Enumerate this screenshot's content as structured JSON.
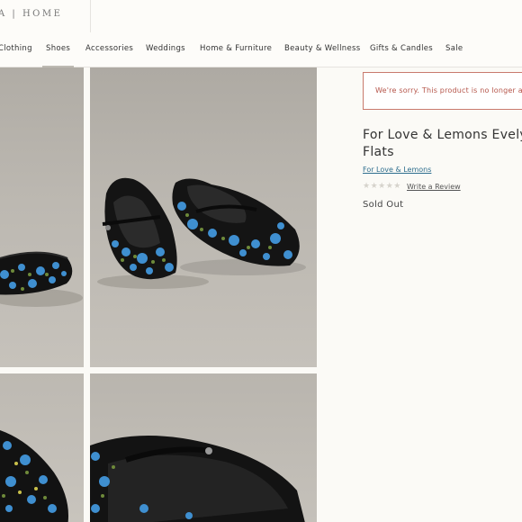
{
  "header": {
    "brand": "A | HOME"
  },
  "nav": {
    "items": [
      {
        "label": "Clothing"
      },
      {
        "label": "Shoes"
      },
      {
        "label": "Accessories"
      },
      {
        "label": "Weddings"
      },
      {
        "label": "Home & Furniture"
      },
      {
        "label": "Beauty & Wellness"
      },
      {
        "label": "Gifts & Candles"
      },
      {
        "label": "Sale"
      }
    ],
    "active": "Shoes"
  },
  "alert": {
    "text": "We're sorry. This product is no longer av"
  },
  "product": {
    "title": "For Love & Lemons Evelyn Flats",
    "brand": "For Love & Lemons",
    "rating_stars": "★★★★★",
    "review_link": "Write a Review",
    "stock_status": "Sold Out"
  },
  "colors": {
    "alert_border": "#c97a6d",
    "alert_text": "#b5554a",
    "link": "#2e6e8e",
    "shoe_body": "#111111",
    "flower_blue": "#3f8fd0"
  }
}
